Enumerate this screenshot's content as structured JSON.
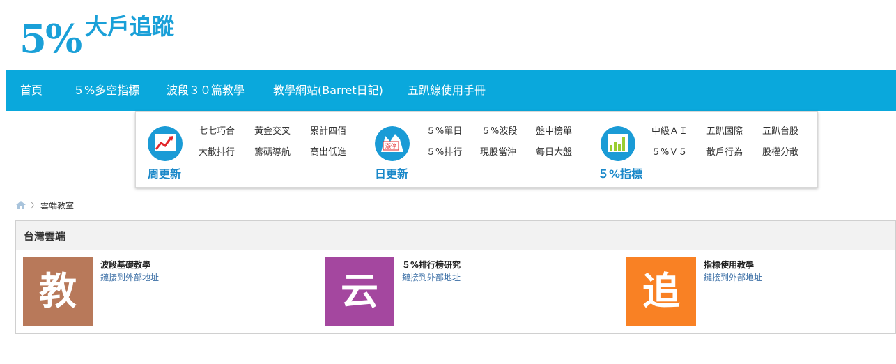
{
  "logo": {
    "percent": "5%",
    "title": "大戶追蹤"
  },
  "nav": {
    "items": [
      {
        "label": "首頁"
      },
      {
        "label": "５%多空指標"
      },
      {
        "label": "波段３０篇教學"
      },
      {
        "label": "教學網站(Barret日記)"
      },
      {
        "label": "五趴線使用手冊"
      }
    ]
  },
  "menu": {
    "groups": [
      {
        "title": "周更新",
        "icon": "trend-chart-icon",
        "color": "#1a9bd6",
        "links": [
          "七七巧合",
          "黃金交叉",
          "累計四佰",
          "大散排行",
          "籌碼導航",
          "高出低進"
        ]
      },
      {
        "title": "日更新",
        "icon": "limit-up-icon",
        "color": "#1a9bd6",
        "badge": "漲停",
        "links": [
          "５%單日",
          "５%波段",
          "盤中榜單",
          "５%排行",
          "現股當沖",
          "每日大盤"
        ]
      },
      {
        "title": "５%指標",
        "icon": "bar-chart-icon",
        "color": "#1a9bd6",
        "links": [
          "中級ＡＩ",
          "五趴國際",
          "五趴台股",
          "５%Ｖ５",
          "散戶行為",
          "股權分散"
        ]
      }
    ]
  },
  "breadcrumb": {
    "separator": "〉",
    "current": "雲端教室"
  },
  "panel": {
    "title": "台灣雲端",
    "cards": [
      {
        "glyph": "教",
        "color": "#b8795a",
        "title": "波段基礎教學",
        "link": "鏈接到外部地址"
      },
      {
        "glyph": "云",
        "color": "#a4479f",
        "title": "５%排行榜研究",
        "link": "鏈接到外部地址"
      },
      {
        "glyph": "追",
        "color": "#f98124",
        "title": "指標使用教學",
        "link": "鏈接到外部地址"
      }
    ]
  },
  "colors": {
    "nav_bg": "#0aa8dc",
    "accent": "#1aa0d8"
  }
}
